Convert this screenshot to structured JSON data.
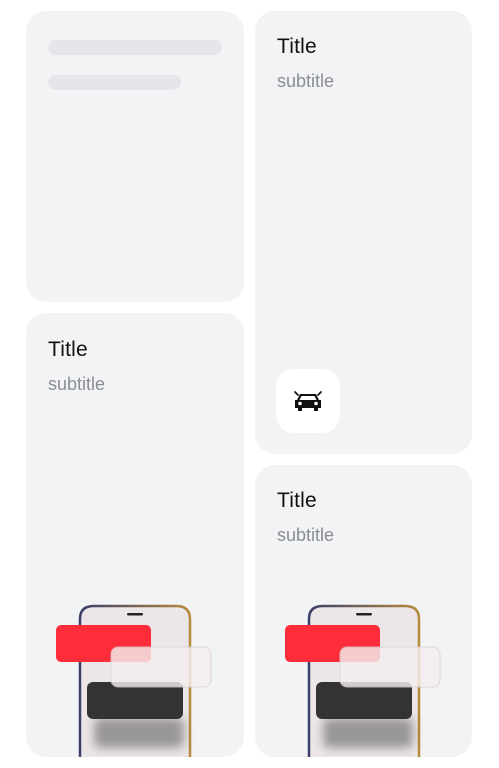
{
  "cards": {
    "loading": {
      "state": "loading"
    },
    "car": {
      "title": "Title",
      "subtitle": "subtitle",
      "icon": "car-icon"
    },
    "phone_left": {
      "title": "Title",
      "subtitle": "subtitle",
      "illustration": "phone-notification-illustration"
    },
    "phone_right": {
      "title": "Title",
      "subtitle": "subtitle",
      "illustration": "phone-notification-illustration"
    }
  },
  "colors": {
    "card_background": "#f2f3f5",
    "skeleton": "#e5e6e9",
    "title": "#111111",
    "subtitle": "#8a8d93",
    "accent_red": "#ff2d3a",
    "phone_screen": "#ece6e8",
    "dark_block": "#333333"
  }
}
